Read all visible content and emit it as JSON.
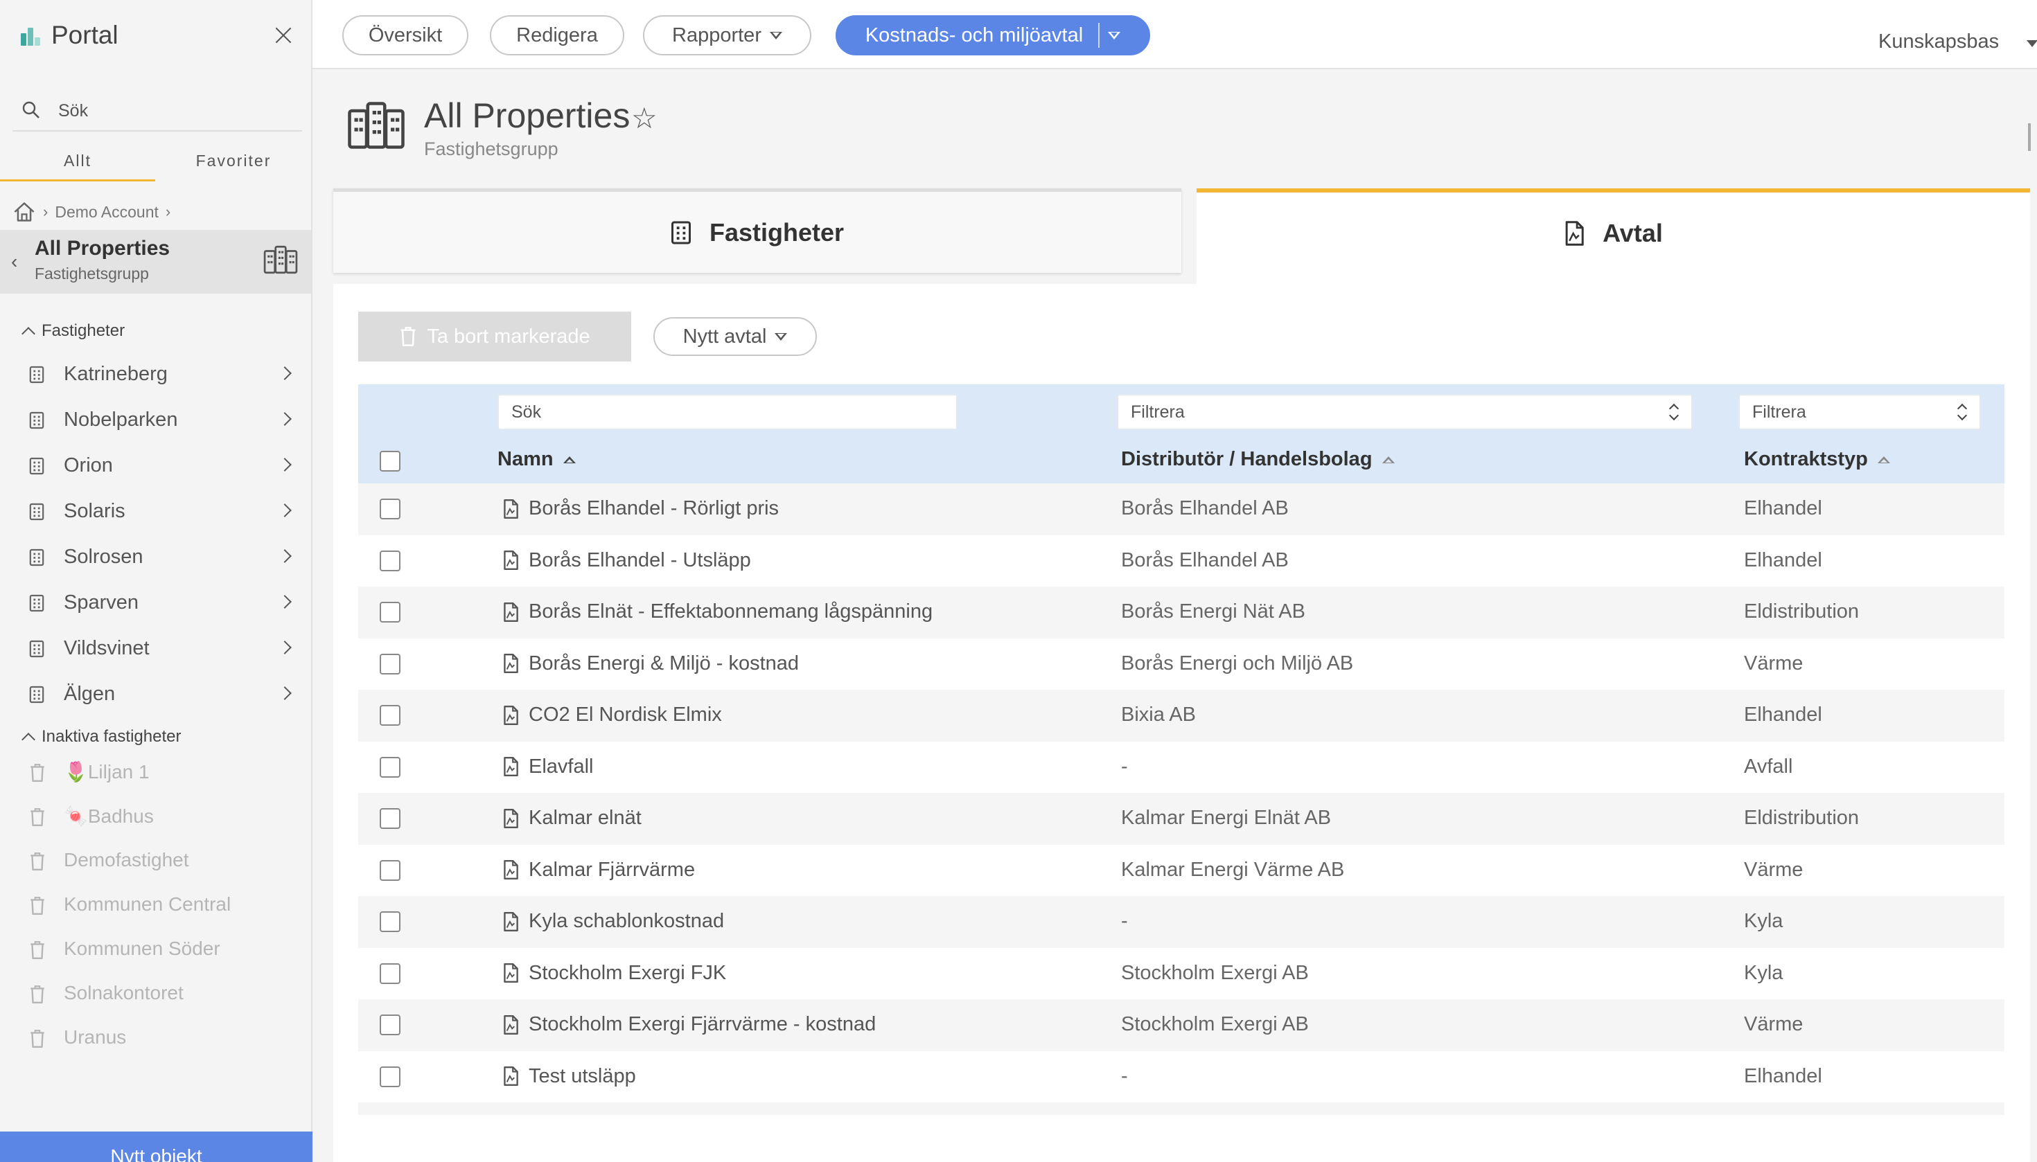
{
  "sidebar": {
    "title": "Portal",
    "search_placeholder": "Sök",
    "tabs": [
      {
        "label": "Allt"
      },
      {
        "label": "Favoriter"
      }
    ],
    "breadcrumb": {
      "account": "Demo Account"
    },
    "group": {
      "name": "All Properties",
      "subtitle": "Fastighetsgrupp"
    },
    "properties_header": "Fastigheter",
    "properties": [
      {
        "label": "Katrineberg"
      },
      {
        "label": "Nobelparken"
      },
      {
        "label": "Orion"
      },
      {
        "label": "Solaris"
      },
      {
        "label": "Solrosen"
      },
      {
        "label": "Sparven"
      },
      {
        "label": "Vildsvinet"
      },
      {
        "label": "Älgen"
      }
    ],
    "inactive_header": "Inaktiva fastigheter",
    "inactive": [
      {
        "label": "🌷Liljan 1"
      },
      {
        "label": "🍬Badhus"
      },
      {
        "label": "Demofastighet"
      },
      {
        "label": "Kommunen Central"
      },
      {
        "label": "Kommunen Söder"
      },
      {
        "label": "Solnakontoret"
      },
      {
        "label": "Uranus"
      }
    ],
    "new_object": "Nytt objekt"
  },
  "nav": {
    "overview": "Översikt",
    "edit": "Redigera",
    "reports": "Rapporter",
    "cost": "Kostnads- och miljöavtal",
    "knowledge": "Kunskapsbas"
  },
  "page": {
    "title": "All Properties",
    "subtitle": "Fastighetsgrupp"
  },
  "content_tabs": {
    "properties": "Fastigheter",
    "agreements": "Avtal"
  },
  "toolbar": {
    "delete_label": "Ta bort markerade",
    "new_label": "Nytt avtal"
  },
  "table": {
    "search_placeholder": "Sök",
    "filter_placeholder": "Filtrera",
    "columns": {
      "name": "Namn",
      "distributor": "Distributör / Handelsbolag",
      "type": "Kontraktstyp"
    },
    "rows": [
      {
        "name": "Borås Elhandel - Rörligt pris",
        "distributor": "Borås Elhandel AB",
        "type": "Elhandel"
      },
      {
        "name": "Borås Elhandel - Utsläpp",
        "distributor": "Borås Elhandel AB",
        "type": "Elhandel"
      },
      {
        "name": "Borås Elnät - Effektabonnemang lågspänning",
        "distributor": "Borås Energi Nät AB",
        "type": "Eldistribution"
      },
      {
        "name": "Borås Energi & Miljö - kostnad",
        "distributor": "Borås Energi och Miljö AB",
        "type": "Värme"
      },
      {
        "name": "CO2 El Nordisk Elmix",
        "distributor": "Bixia AB",
        "type": "Elhandel"
      },
      {
        "name": "Elavfall",
        "distributor": "-",
        "type": "Avfall"
      },
      {
        "name": "Kalmar elnät",
        "distributor": "Kalmar Energi Elnät AB",
        "type": "Eldistribution"
      },
      {
        "name": "Kalmar Fjärrvärme",
        "distributor": "Kalmar Energi Värme AB",
        "type": "Värme"
      },
      {
        "name": "Kyla schablonkostnad",
        "distributor": "-",
        "type": "Kyla"
      },
      {
        "name": "Stockholm Exergi FJK",
        "distributor": "Stockholm Exergi AB",
        "type": "Kyla"
      },
      {
        "name": "Stockholm Exergi Fjärrvärme - kostnad",
        "distributor": "Stockholm Exergi AB",
        "type": "Värme"
      },
      {
        "name": "Test utsläpp",
        "distributor": "-",
        "type": "Elhandel"
      }
    ]
  },
  "colors": {
    "accent": "#5b86e5",
    "tab_active": "#f2b632",
    "table_head": "#dbe8f8",
    "logo": [
      "#3aa89e",
      "#6dc0b8",
      "#a8dcd6"
    ]
  }
}
